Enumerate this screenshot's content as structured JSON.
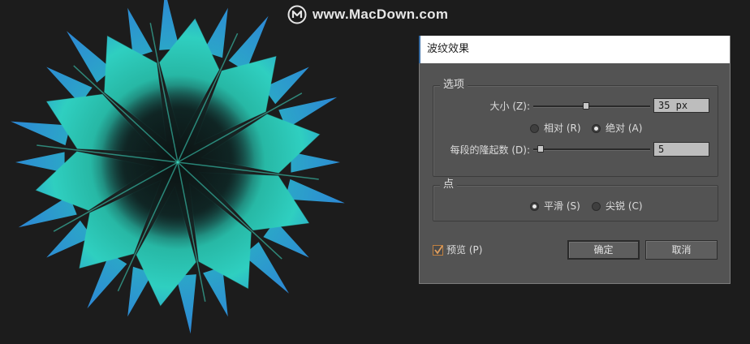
{
  "watermark": {
    "text": "www.MacDown.com",
    "logo_icon": "macdown-m-icon"
  },
  "artwork": {
    "description_icon": "star-burst-artwork",
    "colors": {
      "outer": "#2f8fd8",
      "inner": "#2fd6b8",
      "core": "#0e1a1a"
    }
  },
  "dialog": {
    "title": "波纹效果",
    "options_group": {
      "label": "选项",
      "size_label": "大小 (Z):",
      "size_value": "35 px",
      "size_slider_fraction": 0.45,
      "relative_label": "相对 (R)",
      "absolute_label": "绝对 (A)",
      "absolute_selected": true,
      "ridges_label": "每段的隆起数 (D):",
      "ridges_value": "5",
      "ridges_slider_fraction": 0.04
    },
    "points_group": {
      "label": "点",
      "smooth_label": "平滑 (S)",
      "corner_label": "尖锐 (C)",
      "smooth_selected": true
    },
    "preview_label": "预览 (P)",
    "preview_checked": true,
    "ok_label": "确定",
    "cancel_label": "取消"
  }
}
